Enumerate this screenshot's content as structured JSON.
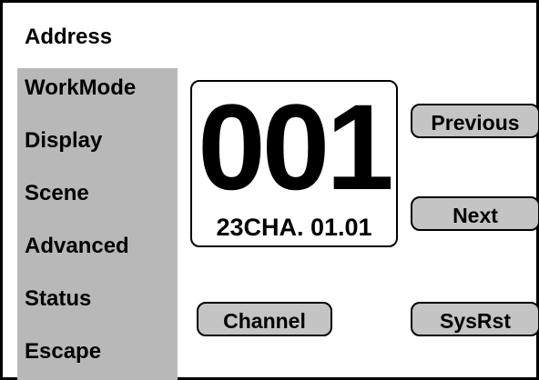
{
  "sidebar": {
    "items": [
      {
        "label": "Address"
      },
      {
        "label": "WorkMode"
      },
      {
        "label": "Display"
      },
      {
        "label": "Scene"
      },
      {
        "label": "Advanced"
      },
      {
        "label": "Status"
      },
      {
        "label": "Escape"
      }
    ],
    "selected": "Address"
  },
  "display": {
    "address": "001",
    "subtitle": "23CHA. 01.01"
  },
  "buttons": {
    "previous": "Previous",
    "next": "Next",
    "channel": "Channel",
    "sysrst": "SysRst"
  },
  "colors": {
    "panel_gray": "#b8b8b8",
    "button_gray": "#c4c4c4",
    "text": "#000000",
    "background": "#ffffff"
  }
}
